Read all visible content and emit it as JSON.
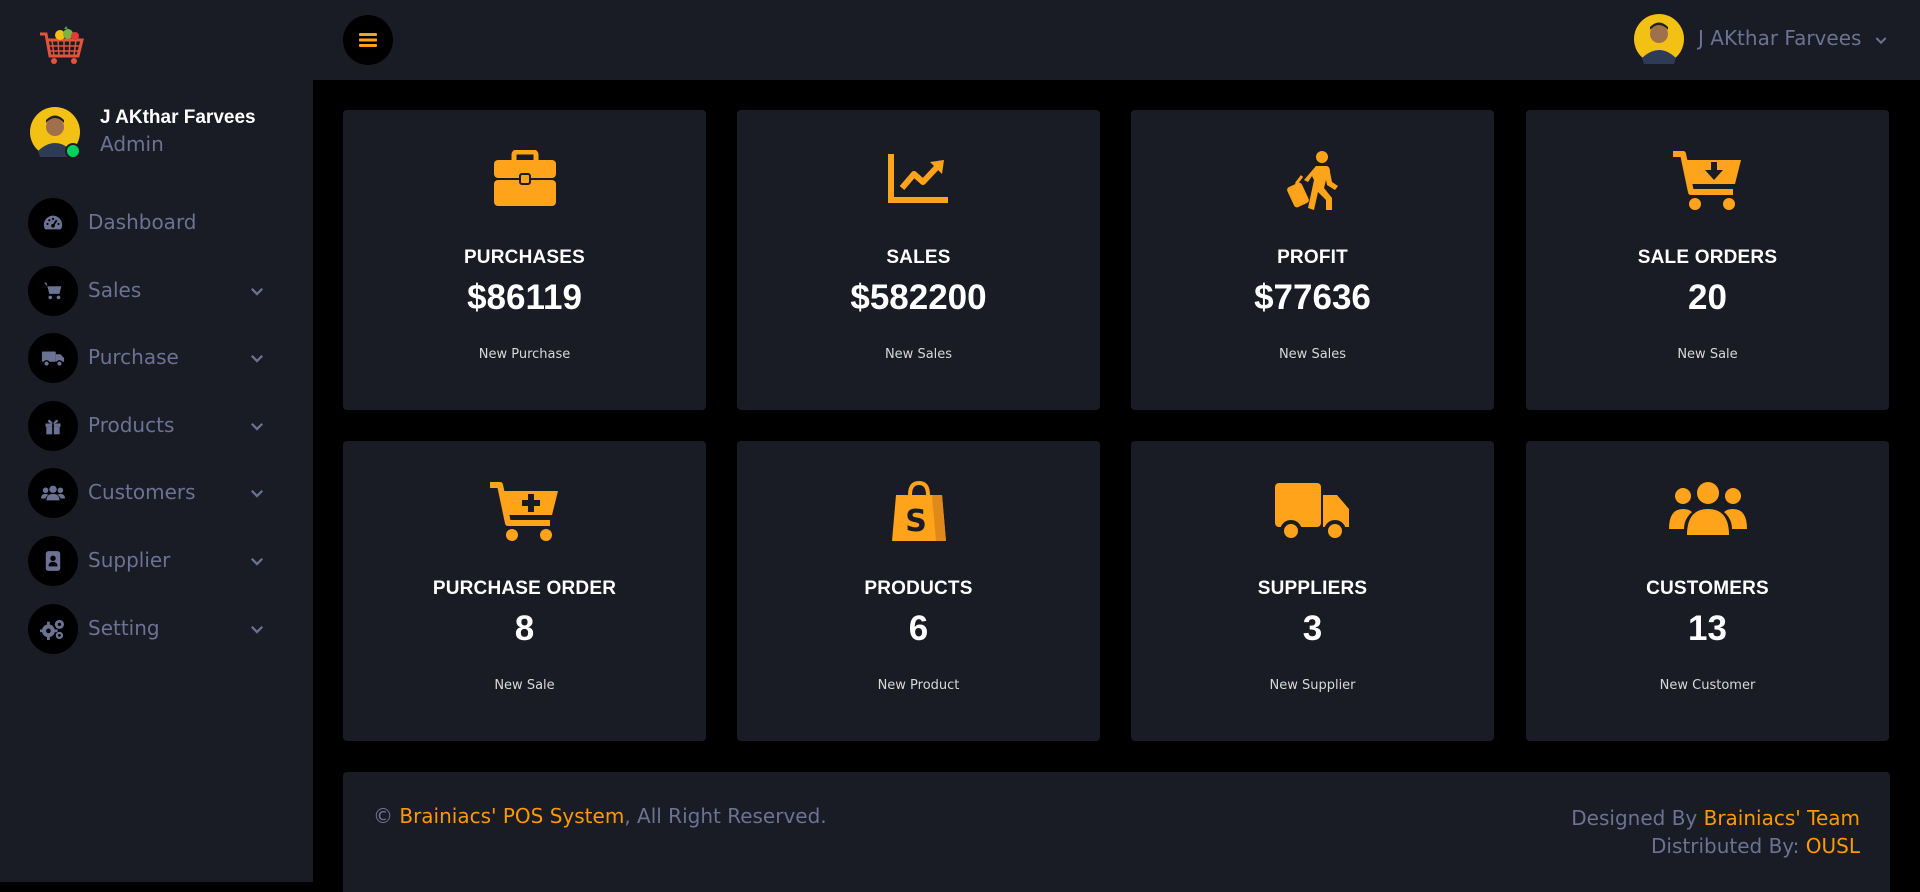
{
  "colors": {
    "accent": "#ffa31a",
    "sidebar": "#191c24",
    "background": "#000000",
    "status_online": "#00d25b"
  },
  "brand": {
    "icon": "shopping-basket-logo-icon"
  },
  "sidebar": {
    "user": {
      "name": "J AKthar Farvees",
      "role": "Admin"
    },
    "items": [
      {
        "label": "Dashboard",
        "icon": "speedometer-icon",
        "has_submenu": false
      },
      {
        "label": "Sales",
        "icon": "cart-icon",
        "has_submenu": true
      },
      {
        "label": " Purchase",
        "icon": "truck-icon",
        "has_submenu": true
      },
      {
        "label": "Products",
        "icon": "gift-icon",
        "has_submenu": true
      },
      {
        "label": "Customers",
        "icon": "users-icon",
        "has_submenu": true
      },
      {
        "label": "Supplier",
        "icon": "contact-book-icon",
        "has_submenu": true
      },
      {
        "label": "Setting",
        "icon": "gears-icon",
        "has_submenu": true
      }
    ]
  },
  "topbar": {
    "menu_icon": "hamburger-icon",
    "user_name": "J AKthar Farvees"
  },
  "cards": [
    {
      "title": "PURCHASES",
      "value": "$86119",
      "sub": "New Purchase",
      "icon": "briefcase-icon"
    },
    {
      "title": "SALES",
      "value": "$582200",
      "sub": "New Sales",
      "icon": "chart-line-icon"
    },
    {
      "title": "PROFIT",
      "value": "$77636",
      "sub": "New Sales",
      "icon": "person-walking-luggage-icon"
    },
    {
      "title": "SALE ORDERS",
      "value": "20",
      "sub": "New Sale",
      "icon": "cart-arrow-down-icon"
    },
    {
      "title": "PURCHASE ORDER",
      "value": "8",
      "sub": "New Sale",
      "icon": "cart-plus-icon"
    },
    {
      "title": "PRODUCTS",
      "value": "6",
      "sub": "New Product",
      "icon": "shopping-bag-icon"
    },
    {
      "title": "SUPPLIERS",
      "value": "3",
      "sub": "New Supplier",
      "icon": "truck-icon"
    },
    {
      "title": "CUSTOMERS",
      "value": "13",
      "sub": "New Customer",
      "icon": "users-icon"
    }
  ],
  "footer": {
    "copyright_symbol": "© ",
    "brand_link": "Brainiacs' POS System",
    "rights": ", All Right Reserved.",
    "designed_by_prefix": "Designed By ",
    "designed_by_link": "Brainiacs' Team",
    "distributed_by_prefix": "Distributed By: ",
    "distributed_by_link": "OUSL"
  }
}
